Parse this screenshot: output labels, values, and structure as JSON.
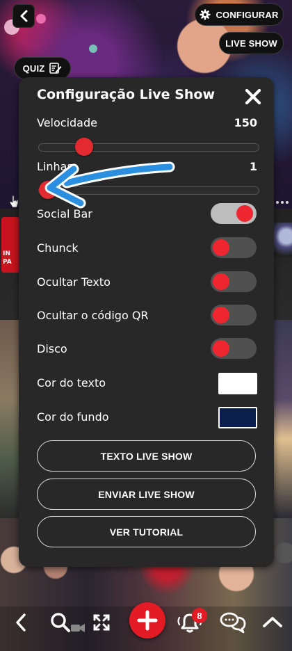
{
  "top": {
    "config_label": "CONFIGURAR",
    "live_label": "LIVE SHOW",
    "quiz_label": "QUIZ"
  },
  "background": {
    "left_tile_text_line1": "IN",
    "left_tile_text_line2": "PA"
  },
  "modal": {
    "title": "Configuração Live Show",
    "speed": {
      "label": "Velocidade",
      "value": "150",
      "level": 0.18
    },
    "lines": {
      "label": "Linhas",
      "value": "1",
      "level": 0.0
    },
    "toggles": [
      {
        "label": "Social Bar",
        "on": true
      },
      {
        "label": "Chunck",
        "on": false
      },
      {
        "label": "Ocultar Texto",
        "on": false
      },
      {
        "label": "Ocultar o código QR",
        "on": false
      },
      {
        "label": "Disco",
        "on": false
      }
    ],
    "text_color": {
      "label": "Cor do texto",
      "color": "#ffffff"
    },
    "bg_color": {
      "label": "Cor do fundo",
      "color": "#0a1f4d"
    },
    "buttons": {
      "text_live": "TEXTO LIVE SHOW",
      "send_live": "ENVIAR LIVE SHOW",
      "tutorial": "VER TUTORIAL"
    }
  },
  "bottom": {
    "notification_count": "8"
  },
  "colors": {
    "accent_red": "#e31b25",
    "annotation_blue": "#2a8fe0"
  }
}
